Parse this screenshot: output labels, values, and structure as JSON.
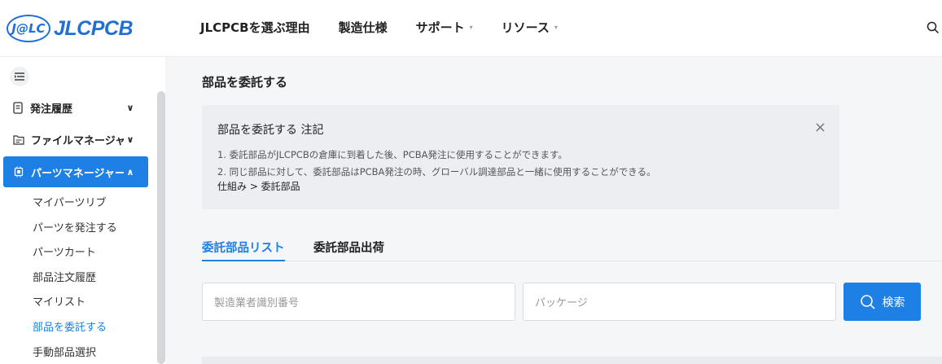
{
  "header": {
    "logo_badge": "J@LC",
    "logo_text": "JLCPCB",
    "nav": [
      {
        "label": "JLCPCBを選ぶ理由",
        "has_caret": false
      },
      {
        "label": "製造仕様",
        "has_caret": false
      },
      {
        "label": "サポート",
        "has_caret": true
      },
      {
        "label": "リソース",
        "has_caret": true
      }
    ],
    "caret": "▾"
  },
  "sidebar": {
    "groups": [
      {
        "label": "発注履歴",
        "chevron": "∨"
      },
      {
        "label": "ファイルマネージャー",
        "chevron": "∨"
      },
      {
        "label": "パーツマネージャー",
        "chevron": "∧"
      }
    ],
    "sub_items": [
      "マイパーツリブ",
      "パーツを発注する",
      "パーツカート",
      "部品注文履歴",
      "マイリスト",
      "部品を委託する",
      "手動部品選択"
    ]
  },
  "main": {
    "title": "部品を委託する",
    "notice": {
      "title": "部品を委託する 注記",
      "close": "×",
      "lines": [
        "1. 委託部品がJLCPCBの倉庫に到着した後、PCBA発注に使用することができます。",
        "2. 同じ部品に対して、委託部品はPCBA発注の時、グローバル調達部品と一緒に使用することができる。"
      ],
      "link": "仕組み > 委託部品"
    },
    "tabs": [
      "委託部品リスト",
      "委託部品出荷"
    ],
    "search": {
      "mpn_placeholder": "製造業者識別番号",
      "package_placeholder": "パッケージ",
      "button": "検索"
    }
  },
  "colors": {
    "accent": "#1e7fe4",
    "brand": "#1f6fd6"
  }
}
